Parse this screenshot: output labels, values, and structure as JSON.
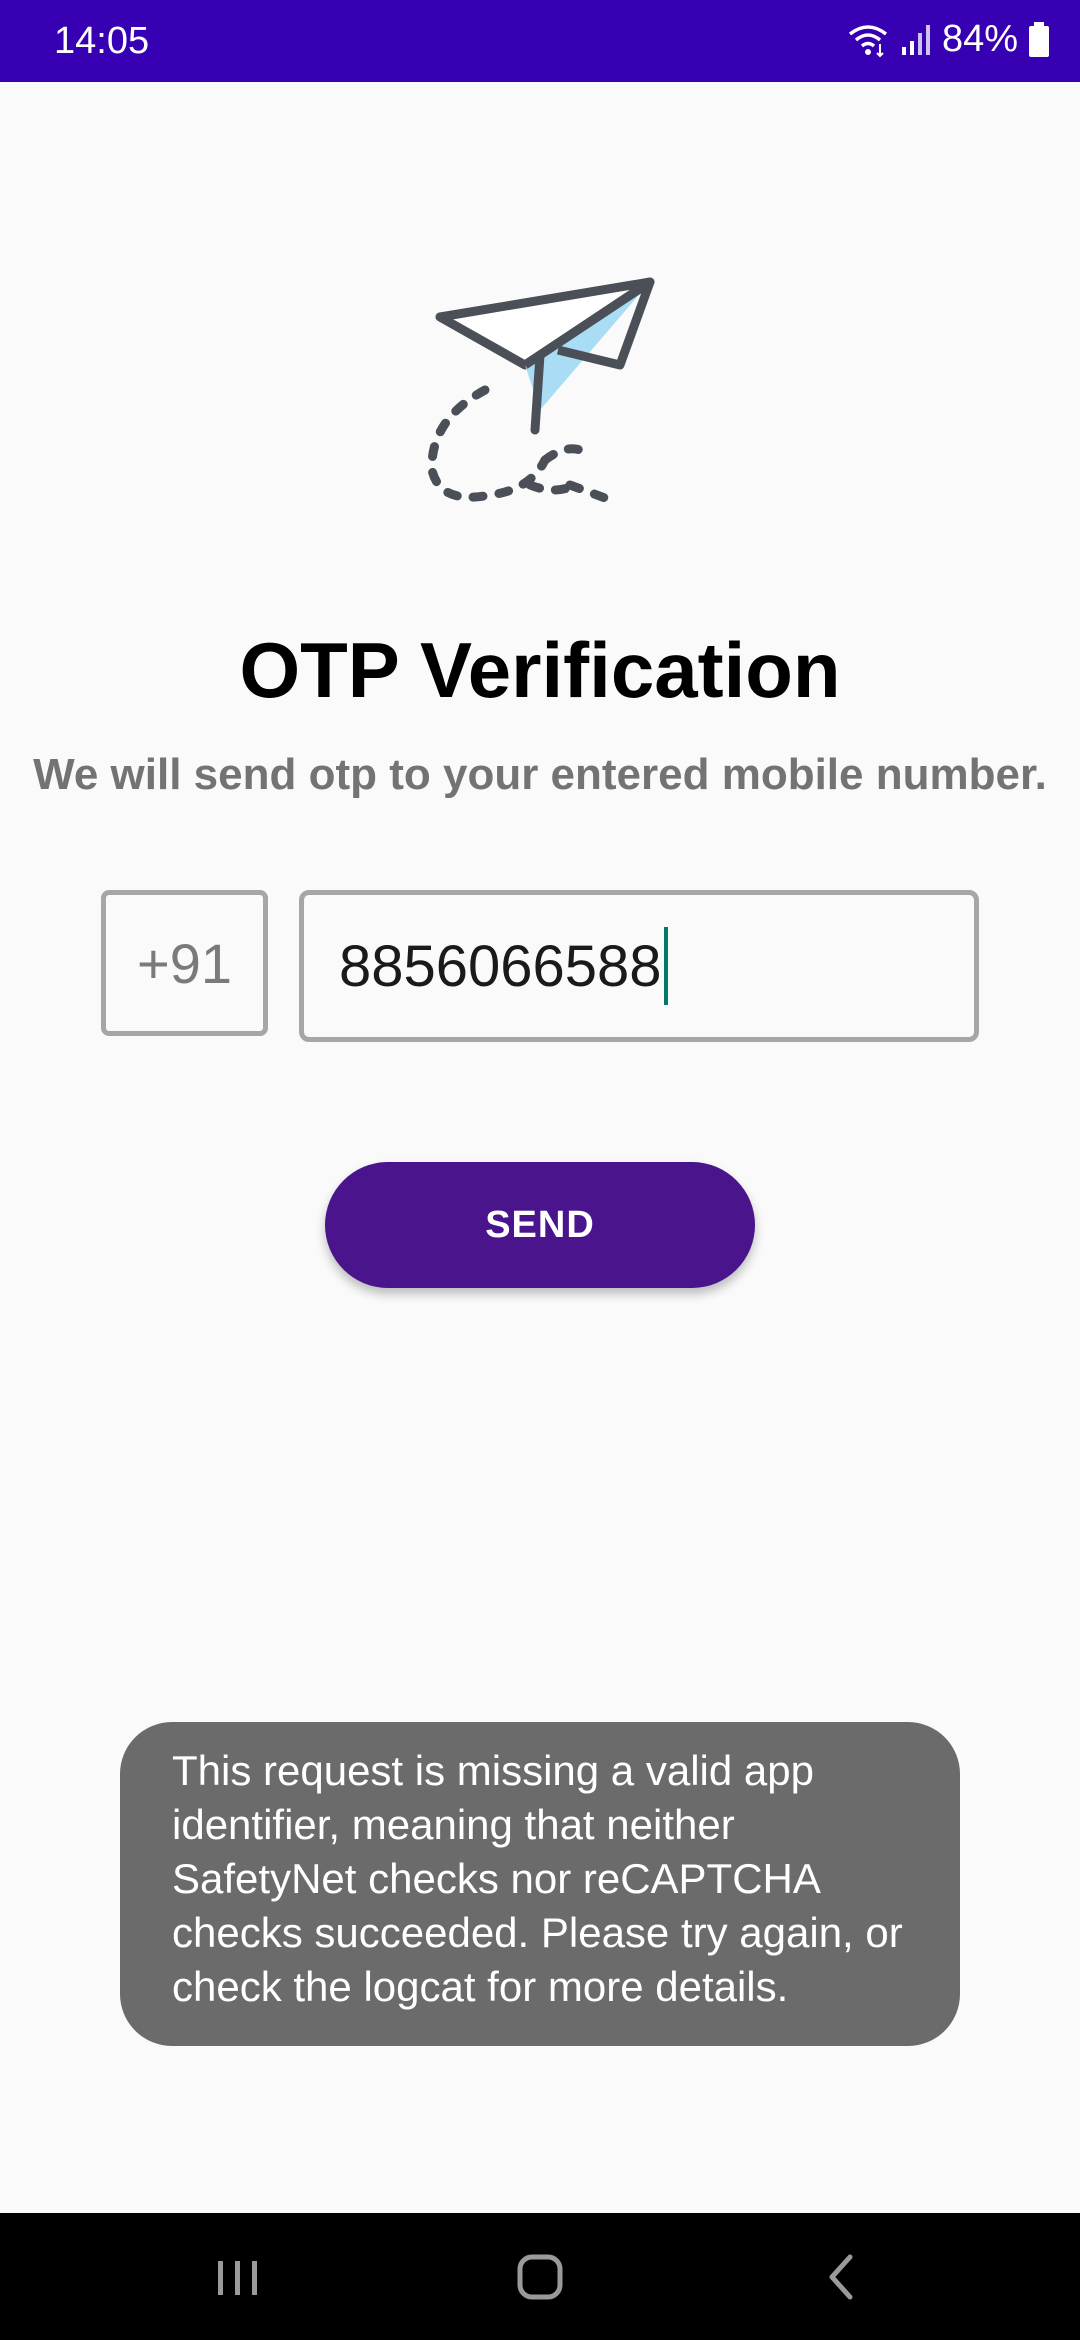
{
  "status_bar": {
    "time": "14:05",
    "battery": "84%",
    "icons": [
      "wifi-icon",
      "signal-icon",
      "battery-icon"
    ]
  },
  "screen": {
    "title": "OTP Verification",
    "subtitle": "We will send otp to your entered mobile number.",
    "country_code": "+91",
    "phone_number": "8856066588",
    "send_label": "SEND"
  },
  "toast": {
    "message": "This request is missing a valid app identifier, meaning that neither SafetyNet checks nor reCAPTCHA checks succeeded. Please try again, or check the logcat for more details."
  },
  "nav_bar": {
    "icons": [
      "recents-icon",
      "home-icon",
      "back-icon"
    ]
  },
  "colors": {
    "status_bar": "#3700b3",
    "button": "#4a148c",
    "toast": "#6b6b6b",
    "accent": "#00796b"
  }
}
